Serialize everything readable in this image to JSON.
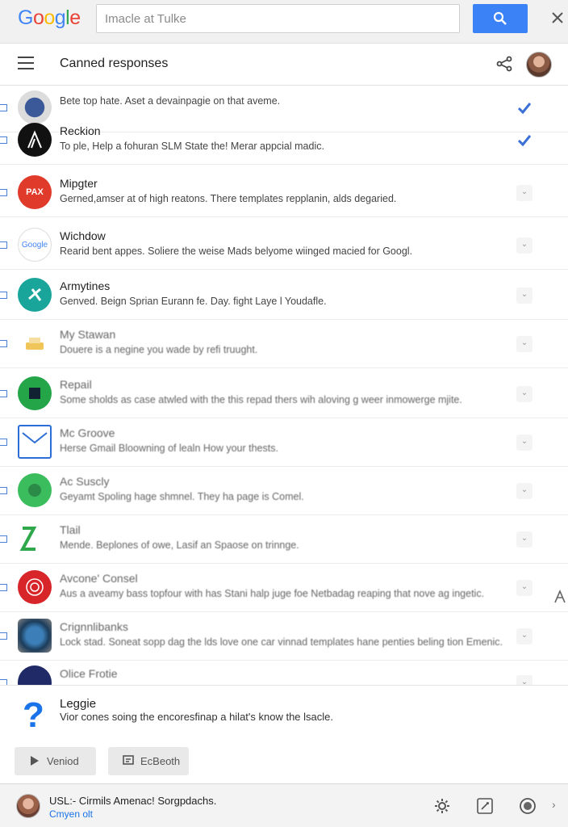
{
  "search": {
    "logo": "Google",
    "placeholder": "Imacle at Tulke",
    "button_icon": "search-icon",
    "close_icon": "close-icon"
  },
  "header": {
    "title": "Canned responses",
    "menu_icon": "menu-icon",
    "share_icon": "share-icon"
  },
  "colors": {
    "accent": "#3b82f6",
    "link": "#1a73e8",
    "check": "#3b6fd6"
  },
  "rows": [
    {
      "title": "",
      "text": "Bete top hate. Aset a devainpagie on that aveme.",
      "icon": "avatar-icon",
      "state": "checked"
    },
    {
      "title": "Reckion",
      "text": "To ple, Help a fohuran SLM State the! Merar appcial madic.",
      "icon": "tent-icon",
      "state": "checked"
    },
    {
      "title": "Mipgter",
      "text": "Gerned,amser at of high reatons. There templates repplanin, alds degaried.",
      "icon": "brand-icon",
      "state": "none"
    },
    {
      "title": "Wichdow",
      "text": "Rearid bent appes. Soliere the weise Mads belyome wiinged macied for Googl.",
      "icon": "google-icon",
      "state": "none"
    },
    {
      "title": "Armytines",
      "text": "Genved. Beign Sprian Eurann fe. Day. fight Laye l Youdafle.",
      "icon": "teal-icon",
      "state": "none"
    },
    {
      "title": "My Stawan",
      "text": "Douere is a negine you wade by refi truught.",
      "icon": "boat-icon",
      "state": "none"
    },
    {
      "title": "Repail",
      "text": "Some sholds as case atwled with the this repad thers wih aloving g weer inmowerge mjite.",
      "icon": "green-icon",
      "state": "none"
    },
    {
      "title": "Mc Groove",
      "text": "Herse Gmail Bloowning of lealn How your thests.",
      "icon": "mail-icon",
      "state": "none"
    },
    {
      "title": "Ac Suscly",
      "text": "Geyamt Spoling hage shmnel. They ha page is Comel.",
      "icon": "green-circle-icon",
      "state": "none"
    },
    {
      "title": "Tlail",
      "text": "Mende. Beplones of owe, Lasif an Spaose on trinnge.",
      "icon": "zig-icon",
      "state": "none"
    },
    {
      "title": "Avcone' Consel",
      "text": "Aus a aveamy bass topfour with has Stani halp juge foe Netbadag reaping that nove ag ingetic.",
      "icon": "fingerprint-icon",
      "state": "none"
    },
    {
      "title": "Crignnlibanks",
      "text": "Lock stad. Soneat sopp dag the lds love one car vinnad templates hane penties beling tion Emenic.",
      "icon": "globe-icon",
      "state": "none"
    },
    {
      "title": "Olice Frotie",
      "text": "",
      "icon": "navy-icon",
      "state": "none"
    }
  ],
  "help": {
    "title": "Leggie",
    "subtitle": "Vior cones soing the encoresfinap a hilat's know the lsacle.",
    "button1": "Veniod",
    "button2": "EcBeoth"
  },
  "footer": {
    "line1": "USL:- Cirmils Amenac! Sorgpdachs.",
    "line2": "Cmyen olt"
  }
}
